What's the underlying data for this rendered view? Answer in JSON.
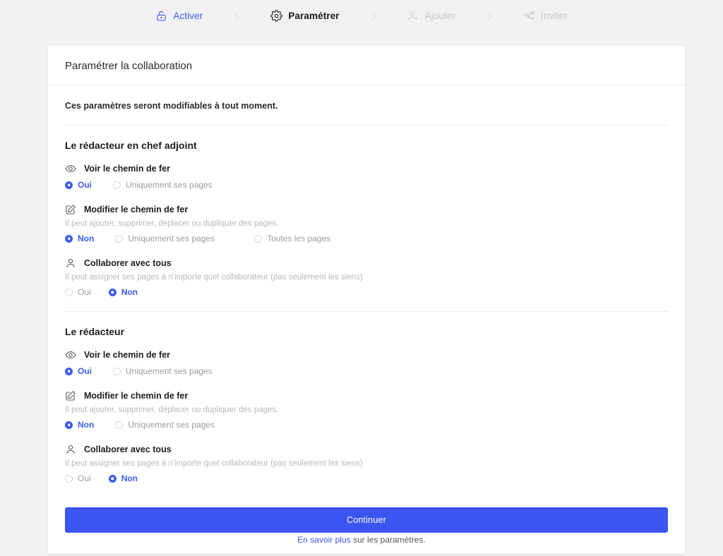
{
  "theme": {
    "accent": "#3b55f0",
    "radio_blue": "#3b5bf5",
    "page_bg": "#f1f1f1",
    "card_bg": "#ffffff",
    "muted_text": "#9a9ca3",
    "desc_text": "#b6b8be",
    "step_todo": "#c3c5cc"
  },
  "stepper": {
    "steps": [
      {
        "label": "Activer",
        "icon": "unlock-icon",
        "state": "done"
      },
      {
        "label": "Paramétrer",
        "icon": "gear-icon",
        "state": "current"
      },
      {
        "label": "Ajouter",
        "icon": "user-plus-icon",
        "state": "todo"
      },
      {
        "label": "Inviter",
        "icon": "paper-plane-icon",
        "state": "todo"
      }
    ]
  },
  "card": {
    "title": "Paramétrer la collaboration",
    "intro": "Ces paramètres seront modifiables à tout moment.",
    "continue_label": "Continuer"
  },
  "sections": [
    {
      "title": "Le rédacteur en chef adjoint",
      "permissions": [
        {
          "name": "Voir le chemin de fer",
          "icon": "eye-icon",
          "description": "",
          "options": [
            {
              "label": "Oui",
              "selected": true
            },
            {
              "label": "Uniquement ses pages",
              "selected": false
            }
          ]
        },
        {
          "name": "Modifier le chemin de fer",
          "icon": "pencil-square-icon",
          "description": "Il peut ajouter, supprimer, déplacer ou dupliquer des pages.",
          "options": [
            {
              "label": "Non",
              "selected": true
            },
            {
              "label": "Uniquement ses pages",
              "selected": false
            },
            {
              "label": "Toutes les pages",
              "selected": false
            }
          ]
        },
        {
          "name": "Collaborer avec tous",
          "icon": "user-icon",
          "description": "Il peut assigner ses pages à n'importe quel collaborateur (pas seulement les siens)",
          "options": [
            {
              "label": "Oui",
              "selected": false
            },
            {
              "label": "Non",
              "selected": true
            }
          ]
        }
      ]
    },
    {
      "title": "Le rédacteur",
      "permissions": [
        {
          "name": "Voir le chemin de fer",
          "icon": "eye-icon",
          "description": "",
          "options": [
            {
              "label": "Oui",
              "selected": true
            },
            {
              "label": "Uniquement ses pages",
              "selected": false
            }
          ]
        },
        {
          "name": "Modifier le chemin de fer",
          "icon": "pencil-square-icon",
          "description": "Il peut ajouter, supprimer, déplacer ou dupliquer des pages.",
          "options": [
            {
              "label": "Non",
              "selected": true
            },
            {
              "label": "Uniquement ses pages",
              "selected": false
            }
          ]
        },
        {
          "name": "Collaborer avec tous",
          "icon": "user-icon",
          "description": "Il peut assigner ses pages à n'importe quel collaborateur (pas seulement les siens)",
          "options": [
            {
              "label": "Oui",
              "selected": false
            },
            {
              "label": "Non",
              "selected": true
            }
          ]
        }
      ]
    }
  ],
  "footer": {
    "link_text": "En savoir plus",
    "rest_text": " sur les paramètres."
  }
}
